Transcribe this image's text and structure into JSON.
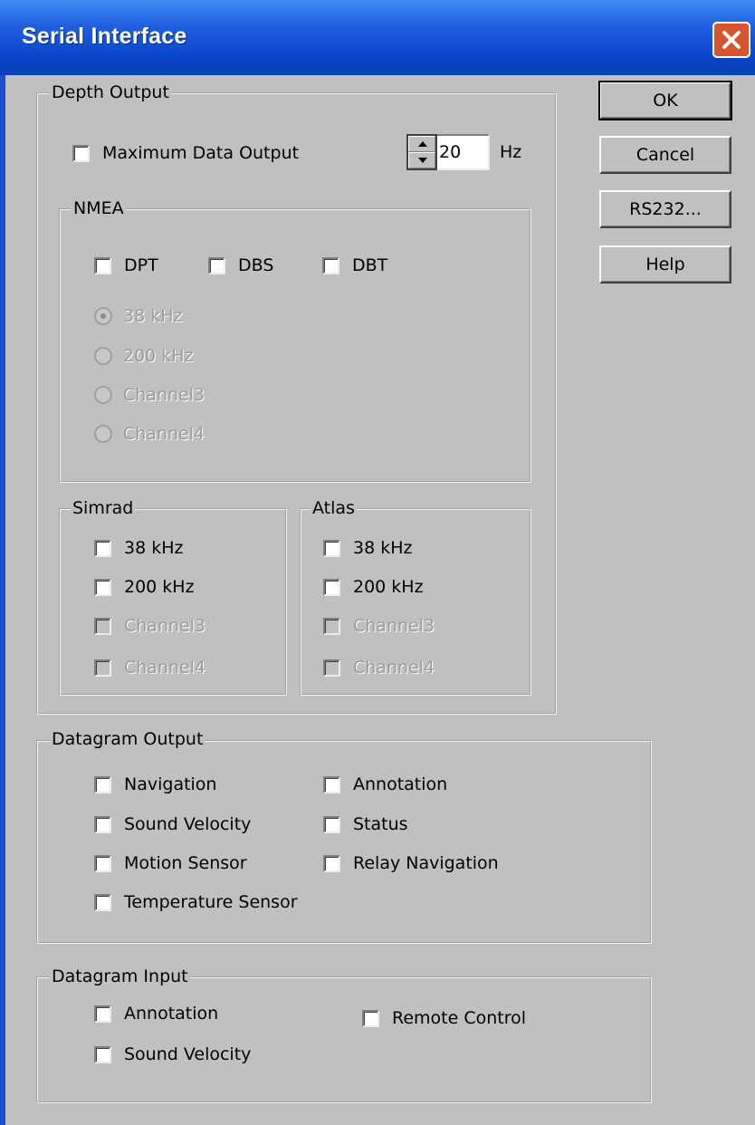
{
  "window": {
    "title": "Serial Interface"
  },
  "buttons": {
    "ok": "OK",
    "cancel": "Cancel",
    "rs232": "RS232...",
    "help": "Help"
  },
  "depth_output": {
    "label": "Depth Output",
    "max_data_output": "Maximum Data Output",
    "frequency_value": "20",
    "frequency_unit": "Hz",
    "nmea": {
      "label": "NMEA",
      "dpt": "DPT",
      "dbs": "DBS",
      "dbt": "DBT",
      "radio_38": "38 kHz",
      "radio_200": "200 kHz",
      "radio_ch3": "Channel3",
      "radio_ch4": "Channel4"
    },
    "simrad": {
      "label": "Simrad",
      "f38": "38 kHz",
      "f200": "200 kHz",
      "ch3": "Channel3",
      "ch4": "Channel4"
    },
    "atlas": {
      "label": "Atlas",
      "f38": "38 kHz",
      "f200": "200 kHz",
      "ch3": "Channel3",
      "ch4": "Channel4"
    }
  },
  "datagram_output": {
    "label": "Datagram Output",
    "navigation": "Navigation",
    "sound_velocity": "Sound Velocity",
    "motion_sensor": "Motion Sensor",
    "temperature_sensor": "Temperature Sensor",
    "annotation": "Annotation",
    "status": "Status",
    "relay_navigation": "Relay Navigation"
  },
  "datagram_input": {
    "label": "Datagram Input",
    "annotation": "Annotation",
    "sound_velocity": "Sound Velocity",
    "remote_control": "Remote Control"
  },
  "icons": {
    "close": "close-icon",
    "spin_up": "spin-up-icon",
    "spin_down": "spin-down-icon"
  },
  "colors": {
    "title_bar": "#0a46c9",
    "dialog_bg": "#c0c0c0",
    "close_button": "#d8532f"
  }
}
